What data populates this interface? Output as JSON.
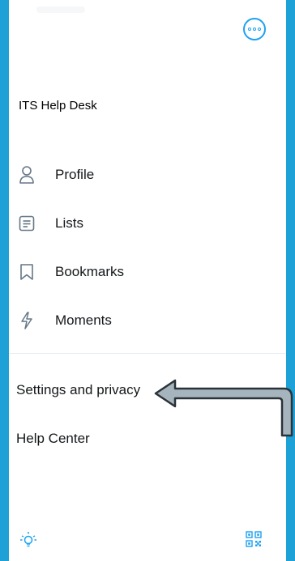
{
  "account": {
    "name": "ITS Help Desk"
  },
  "menu": {
    "items": [
      {
        "label": "Profile",
        "icon": "person-icon"
      },
      {
        "label": "Lists",
        "icon": "list-icon"
      },
      {
        "label": "Bookmarks",
        "icon": "bookmark-icon"
      },
      {
        "label": "Moments",
        "icon": "lightning-icon"
      }
    ],
    "settings_label": "Settings and privacy",
    "help_label": "Help Center"
  },
  "colors": {
    "accent": "#1DA1F2",
    "frame": "#1DA1D6",
    "text": "#14171A",
    "icon": "#657786",
    "arrow_fill": "#A6B5BD"
  }
}
